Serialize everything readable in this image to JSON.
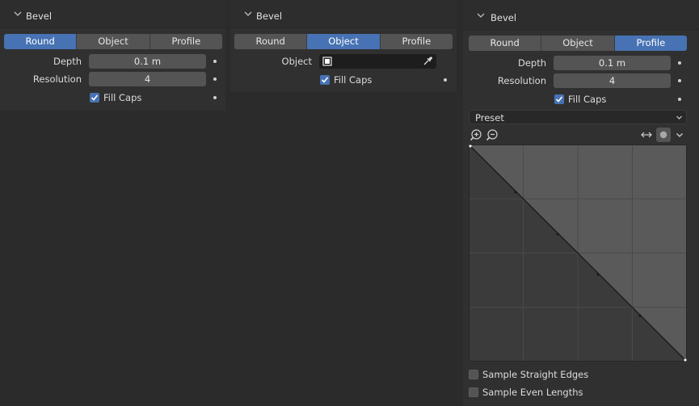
{
  "panel_round": {
    "title": "Bevel",
    "tabs": [
      {
        "label": "Round",
        "active": true
      },
      {
        "label": "Object",
        "active": false
      },
      {
        "label": "Profile",
        "active": false
      }
    ],
    "depth_label": "Depth",
    "depth_value": "0.1 m",
    "resolution_label": "Resolution",
    "resolution_value": "4",
    "fill_caps_label": "Fill Caps",
    "fill_caps_checked": true
  },
  "panel_object": {
    "title": "Bevel",
    "tabs": [
      {
        "label": "Round",
        "active": false
      },
      {
        "label": "Object",
        "active": true
      },
      {
        "label": "Profile",
        "active": false
      }
    ],
    "object_label": "Object",
    "object_value": "",
    "fill_caps_label": "Fill Caps",
    "fill_caps_checked": true
  },
  "panel_profile": {
    "title": "Bevel",
    "tabs": [
      {
        "label": "Round",
        "active": false
      },
      {
        "label": "Object",
        "active": false
      },
      {
        "label": "Profile",
        "active": true
      }
    ],
    "depth_label": "Depth",
    "depth_value": "0.1 m",
    "resolution_label": "Resolution",
    "resolution_value": "4",
    "fill_caps_label": "Fill Caps",
    "fill_caps_checked": true,
    "preset_label": "Preset",
    "sample_straight_label": "Sample Straight Edges",
    "sample_straight_checked": false,
    "sample_even_label": "Sample Even Lengths",
    "sample_even_checked": false
  },
  "colors": {
    "accent": "#4772b3",
    "panel_bg": "#303030",
    "field_bg": "#545454",
    "graph_fill": "#5a5a5a",
    "graph_empty": "#3b3b3b"
  },
  "icons": {
    "collapse": "chevron-down-icon",
    "zoom_in": "zoom-in-icon",
    "zoom_out": "zoom-out-icon",
    "reverse": "reverse-arrows-icon",
    "clip": "clip-dot-icon",
    "more": "chevron-down-icon",
    "eyedropper": "eyedropper-icon",
    "object": "object-icon"
  }
}
